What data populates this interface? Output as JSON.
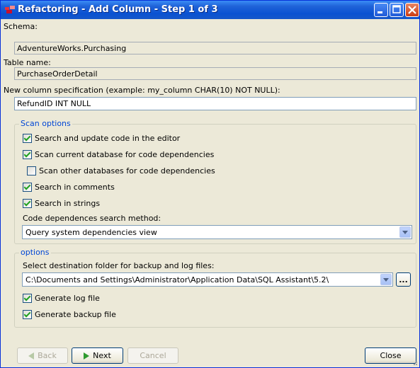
{
  "window": {
    "title": "Refactoring - Add Column - Step 1 of 3"
  },
  "schema": {
    "label": "Schema:",
    "value": "AdventureWorks.Purchasing"
  },
  "table": {
    "label": "Table name:",
    "value": "PurchaseOrderDetail"
  },
  "column_spec": {
    "label": "New column specification (example: my_column CHAR(10) NOT NULL):",
    "value": "RefundID INT NULL"
  },
  "scan_options": {
    "title": "Scan options",
    "items": [
      {
        "label": "Search and update code in the editor",
        "checked": true
      },
      {
        "label": "Scan current database for code dependencies",
        "checked": true
      },
      {
        "label": "Scan other databases for code dependencies",
        "checked": false
      },
      {
        "label": "Search in comments",
        "checked": true
      },
      {
        "label": "Search in strings",
        "checked": true
      }
    ],
    "method_label": "Code dependences search method:",
    "method_value": "Query system dependencies view"
  },
  "options": {
    "title": "options",
    "folder_label": "Select destination folder for backup and log files:",
    "folder_value": "C:\\Documents and Settings\\Administrator\\Application Data\\SQL Assistant\\5.2\\",
    "browse_label": "...",
    "items": [
      {
        "label": "Generate log file",
        "checked": true
      },
      {
        "label": "Generate backup file",
        "checked": true
      }
    ]
  },
  "buttons": {
    "back": "Back",
    "next": "Next",
    "cancel": "Cancel",
    "close": "Close"
  }
}
